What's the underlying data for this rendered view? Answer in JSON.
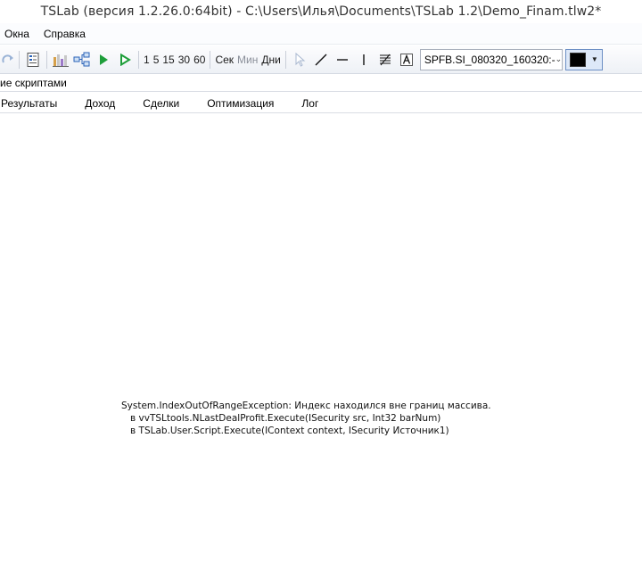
{
  "window": {
    "title": "TSLab (версия 1.2.26.0:64bit) - C:\\Users\\Илья\\Documents\\TSLab 1.2\\Demo_Finam.tlw2*"
  },
  "menu": {
    "items": [
      "Окна",
      "Справка"
    ]
  },
  "toolbar": {
    "intervals": [
      "1",
      "5",
      "15",
      "30",
      "60"
    ],
    "units": [
      "Сек",
      "Мин",
      "Дни"
    ],
    "security_value": "SPFB.SI_080320_160320:-",
    "color": "#000000"
  },
  "scripts_bar": {
    "label": "ие скриптами"
  },
  "tabs": [
    "Результаты",
    "Доход",
    "Сделки",
    "Оптимизация",
    "Лог"
  ],
  "error": {
    "lines": [
      "System.IndexOutOfRangeException: Индекс находился вне границ массива.",
      "   в vvTSLtools.NLastDealProfit.Execute(ISecurity src, Int32 barNum)",
      "   в TSLab.User.Script.Execute(IContext context, ISecurity Источник1)"
    ]
  }
}
